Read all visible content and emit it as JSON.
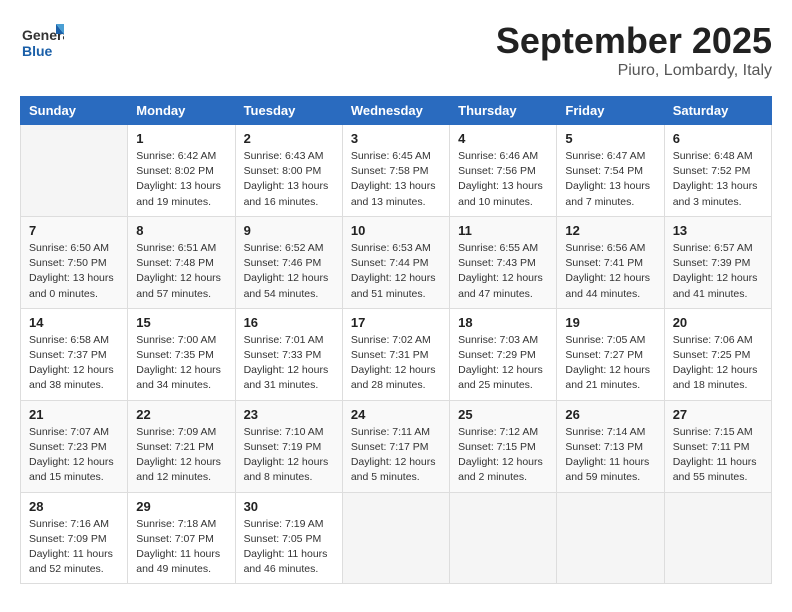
{
  "header": {
    "logo_line1": "General",
    "logo_line2": "Blue",
    "month": "September 2025",
    "location": "Piuro, Lombardy, Italy"
  },
  "days_of_week": [
    "Sunday",
    "Monday",
    "Tuesday",
    "Wednesday",
    "Thursday",
    "Friday",
    "Saturday"
  ],
  "weeks": [
    [
      {
        "day": "",
        "info": ""
      },
      {
        "day": "1",
        "info": "Sunrise: 6:42 AM\nSunset: 8:02 PM\nDaylight: 13 hours\nand 19 minutes."
      },
      {
        "day": "2",
        "info": "Sunrise: 6:43 AM\nSunset: 8:00 PM\nDaylight: 13 hours\nand 16 minutes."
      },
      {
        "day": "3",
        "info": "Sunrise: 6:45 AM\nSunset: 7:58 PM\nDaylight: 13 hours\nand 13 minutes."
      },
      {
        "day": "4",
        "info": "Sunrise: 6:46 AM\nSunset: 7:56 PM\nDaylight: 13 hours\nand 10 minutes."
      },
      {
        "day": "5",
        "info": "Sunrise: 6:47 AM\nSunset: 7:54 PM\nDaylight: 13 hours\nand 7 minutes."
      },
      {
        "day": "6",
        "info": "Sunrise: 6:48 AM\nSunset: 7:52 PM\nDaylight: 13 hours\nand 3 minutes."
      }
    ],
    [
      {
        "day": "7",
        "info": "Sunrise: 6:50 AM\nSunset: 7:50 PM\nDaylight: 13 hours\nand 0 minutes."
      },
      {
        "day": "8",
        "info": "Sunrise: 6:51 AM\nSunset: 7:48 PM\nDaylight: 12 hours\nand 57 minutes."
      },
      {
        "day": "9",
        "info": "Sunrise: 6:52 AM\nSunset: 7:46 PM\nDaylight: 12 hours\nand 54 minutes."
      },
      {
        "day": "10",
        "info": "Sunrise: 6:53 AM\nSunset: 7:44 PM\nDaylight: 12 hours\nand 51 minutes."
      },
      {
        "day": "11",
        "info": "Sunrise: 6:55 AM\nSunset: 7:43 PM\nDaylight: 12 hours\nand 47 minutes."
      },
      {
        "day": "12",
        "info": "Sunrise: 6:56 AM\nSunset: 7:41 PM\nDaylight: 12 hours\nand 44 minutes."
      },
      {
        "day": "13",
        "info": "Sunrise: 6:57 AM\nSunset: 7:39 PM\nDaylight: 12 hours\nand 41 minutes."
      }
    ],
    [
      {
        "day": "14",
        "info": "Sunrise: 6:58 AM\nSunset: 7:37 PM\nDaylight: 12 hours\nand 38 minutes."
      },
      {
        "day": "15",
        "info": "Sunrise: 7:00 AM\nSunset: 7:35 PM\nDaylight: 12 hours\nand 34 minutes."
      },
      {
        "day": "16",
        "info": "Sunrise: 7:01 AM\nSunset: 7:33 PM\nDaylight: 12 hours\nand 31 minutes."
      },
      {
        "day": "17",
        "info": "Sunrise: 7:02 AM\nSunset: 7:31 PM\nDaylight: 12 hours\nand 28 minutes."
      },
      {
        "day": "18",
        "info": "Sunrise: 7:03 AM\nSunset: 7:29 PM\nDaylight: 12 hours\nand 25 minutes."
      },
      {
        "day": "19",
        "info": "Sunrise: 7:05 AM\nSunset: 7:27 PM\nDaylight: 12 hours\nand 21 minutes."
      },
      {
        "day": "20",
        "info": "Sunrise: 7:06 AM\nSunset: 7:25 PM\nDaylight: 12 hours\nand 18 minutes."
      }
    ],
    [
      {
        "day": "21",
        "info": "Sunrise: 7:07 AM\nSunset: 7:23 PM\nDaylight: 12 hours\nand 15 minutes."
      },
      {
        "day": "22",
        "info": "Sunrise: 7:09 AM\nSunset: 7:21 PM\nDaylight: 12 hours\nand 12 minutes."
      },
      {
        "day": "23",
        "info": "Sunrise: 7:10 AM\nSunset: 7:19 PM\nDaylight: 12 hours\nand 8 minutes."
      },
      {
        "day": "24",
        "info": "Sunrise: 7:11 AM\nSunset: 7:17 PM\nDaylight: 12 hours\nand 5 minutes."
      },
      {
        "day": "25",
        "info": "Sunrise: 7:12 AM\nSunset: 7:15 PM\nDaylight: 12 hours\nand 2 minutes."
      },
      {
        "day": "26",
        "info": "Sunrise: 7:14 AM\nSunset: 7:13 PM\nDaylight: 11 hours\nand 59 minutes."
      },
      {
        "day": "27",
        "info": "Sunrise: 7:15 AM\nSunset: 7:11 PM\nDaylight: 11 hours\nand 55 minutes."
      }
    ],
    [
      {
        "day": "28",
        "info": "Sunrise: 7:16 AM\nSunset: 7:09 PM\nDaylight: 11 hours\nand 52 minutes."
      },
      {
        "day": "29",
        "info": "Sunrise: 7:18 AM\nSunset: 7:07 PM\nDaylight: 11 hours\nand 49 minutes."
      },
      {
        "day": "30",
        "info": "Sunrise: 7:19 AM\nSunset: 7:05 PM\nDaylight: 11 hours\nand 46 minutes."
      },
      {
        "day": "",
        "info": ""
      },
      {
        "day": "",
        "info": ""
      },
      {
        "day": "",
        "info": ""
      },
      {
        "day": "",
        "info": ""
      }
    ]
  ]
}
